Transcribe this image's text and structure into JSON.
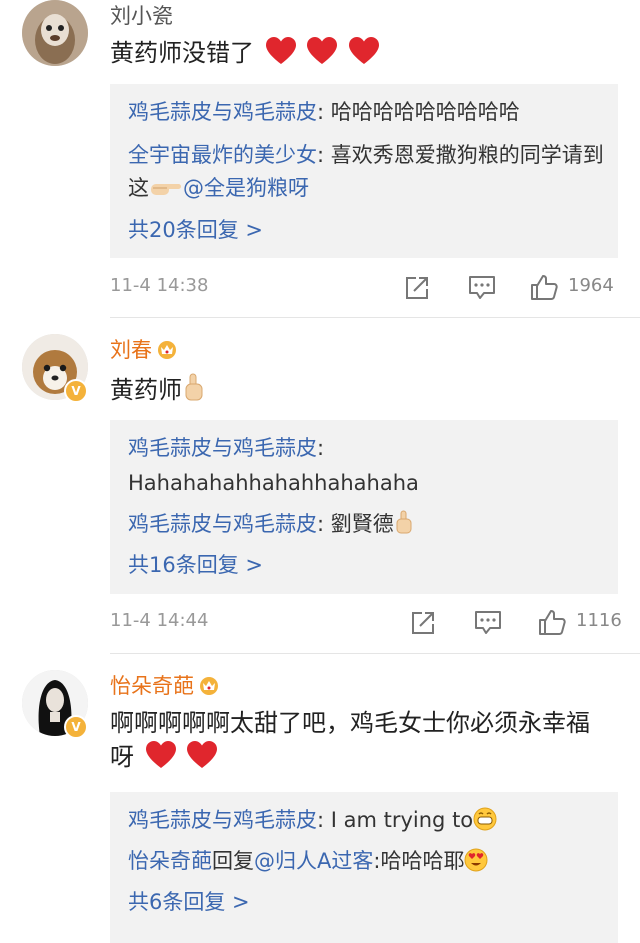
{
  "comments": [
    {
      "user": "刘小瓷",
      "text": "黄药师没错了",
      "replies": [
        {
          "name": "鸡毛蒜皮与鸡毛蒜皮",
          "sep": ":",
          "text": " 哈哈哈哈哈哈哈哈哈"
        },
        {
          "name": "全宇宙最炸的美少女",
          "sep": ":",
          "text": " 喜欢秀恩爱撒狗粮的同学请到这",
          "mention": "@全是狗粮呀"
        }
      ],
      "more": "共20条回复 >",
      "time": "11-4 14:38",
      "likes": "1964"
    },
    {
      "user": "刘春",
      "text": "黄药师",
      "replies": [
        {
          "name": "鸡毛蒜皮与鸡毛蒜皮",
          "sep": ":",
          "text": ""
        },
        {
          "name": "",
          "sep": "",
          "text": "Hahahahahhahahhahahaha"
        },
        {
          "name": "鸡毛蒜皮与鸡毛蒜皮",
          "sep": ":",
          "text": " 劉賢德"
        }
      ],
      "more": "共16条回复 >",
      "time": "11-4 14:44",
      "likes": "1116"
    },
    {
      "user": "怡朵奇葩",
      "text": "啊啊啊啊啊太甜了吧，鸡毛女士你必须永幸福呀",
      "replies": [
        {
          "name": "鸡毛蒜皮与鸡毛蒜皮",
          "sep": ":",
          "text": " I am trying to"
        },
        {
          "name": "怡朵奇葩",
          "sep": "",
          "text": "",
          "middle": "回复",
          "name2": "@归人A过客",
          "text2": ":哈哈哈耶"
        }
      ],
      "more": "共6条回复 >"
    }
  ],
  "colors": {
    "link": "#3b67b0",
    "vip_name": "#e8731a",
    "heart": "#e0262d",
    "badge": "#f4b23a"
  }
}
